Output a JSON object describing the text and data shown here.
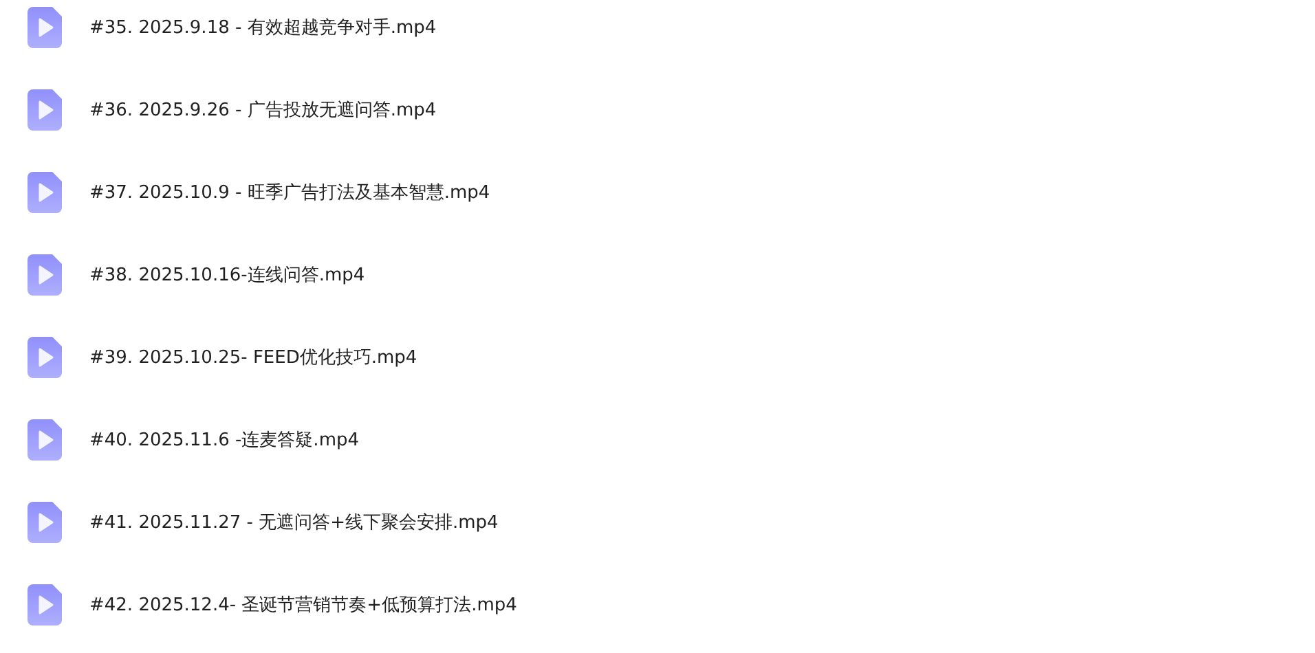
{
  "files": [
    {
      "name": "#35. 2025.9.18 - 有效超越竞争对手.mp4"
    },
    {
      "name": "#36. 2025.9.26 - 广告投放无遮问答.mp4"
    },
    {
      "name": "#37. 2025.10.9 - 旺季广告打法及基本智慧.mp4"
    },
    {
      "name": "#38. 2025.10.16-连线问答.mp4"
    },
    {
      "name": "#39. 2025.10.25- FEED优化技巧.mp4"
    },
    {
      "name": "#40. 2025.11.6 -连麦答疑.mp4"
    },
    {
      "name": "#41. 2025.11.27 - 无遮问答+线下聚会安排.mp4"
    },
    {
      "name": "#42. 2025.12.4- 圣诞节营销节奏+低预算打法.mp4"
    }
  ]
}
